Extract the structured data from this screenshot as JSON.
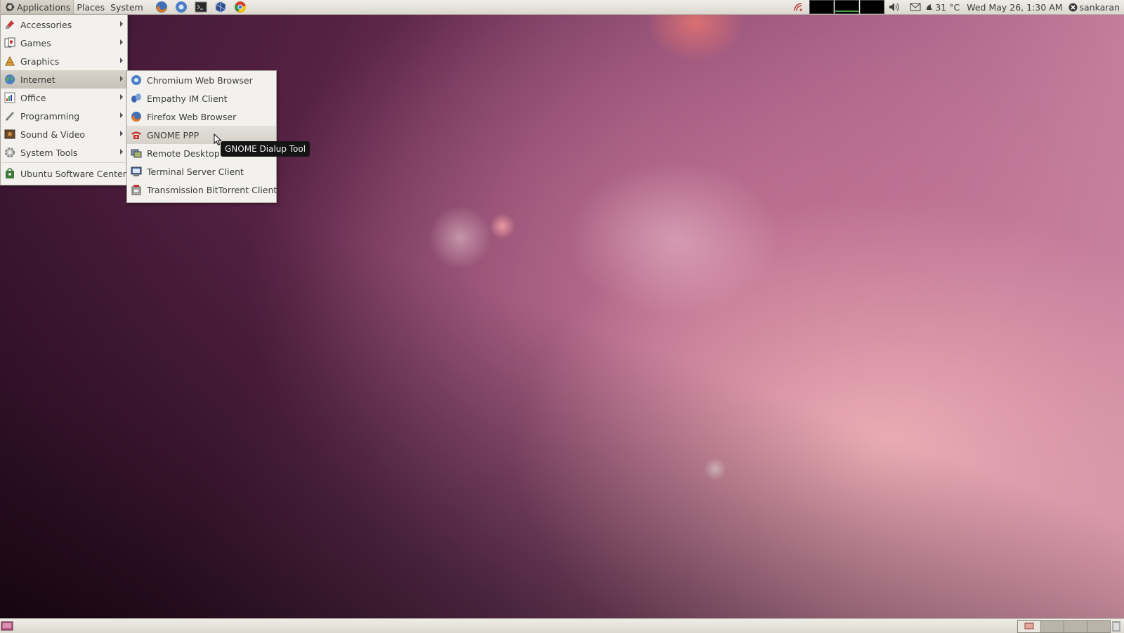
{
  "top_panel": {
    "menus": [
      "Applications",
      "Places",
      "System"
    ],
    "launchers": [
      "firefox-icon",
      "chromium-icon",
      "terminal-icon",
      "virtualbox-icon",
      "chrome-icon"
    ],
    "tray": {
      "temperature": "31 °C",
      "datetime": "Wed May 26,  1:30 AM",
      "user": "sankaran"
    }
  },
  "applications_menu": {
    "items": [
      {
        "label": "Accessories",
        "icon": "accessories-icon",
        "submenu": true
      },
      {
        "label": "Games",
        "icon": "games-icon",
        "submenu": true
      },
      {
        "label": "Graphics",
        "icon": "graphics-icon",
        "submenu": true
      },
      {
        "label": "Internet",
        "icon": "internet-icon",
        "submenu": true,
        "highlighted": true
      },
      {
        "label": "Office",
        "icon": "office-icon",
        "submenu": true
      },
      {
        "label": "Programming",
        "icon": "programming-icon",
        "submenu": true
      },
      {
        "label": "Sound & Video",
        "icon": "sound-video-icon",
        "submenu": true
      },
      {
        "label": "System Tools",
        "icon": "system-tools-icon",
        "submenu": true
      },
      {
        "label": "Ubuntu Software Center",
        "icon": "software-center-icon",
        "submenu": false
      }
    ]
  },
  "internet_submenu": {
    "items": [
      {
        "label": "Chromium Web Browser",
        "icon": "chromium-icon"
      },
      {
        "label": "Empathy IM Client",
        "icon": "empathy-icon"
      },
      {
        "label": "Firefox Web Browser",
        "icon": "firefox-icon"
      },
      {
        "label": "GNOME PPP",
        "icon": "phone-icon",
        "hovered": true
      },
      {
        "label": "Remote Desktop Viewer",
        "icon": "remote-desktop-icon"
      },
      {
        "label": "Terminal Server Client",
        "icon": "terminal-server-icon"
      },
      {
        "label": "Transmission BitTorrent Client",
        "icon": "transmission-icon"
      }
    ]
  },
  "tooltip": {
    "text": "GNOME Dialup Tool"
  },
  "colors": {
    "panel": "#dcd8d0",
    "menu_bg": "#f2f1ee",
    "highlight": "#ccc7bd",
    "tooltip_bg": "#141414"
  }
}
